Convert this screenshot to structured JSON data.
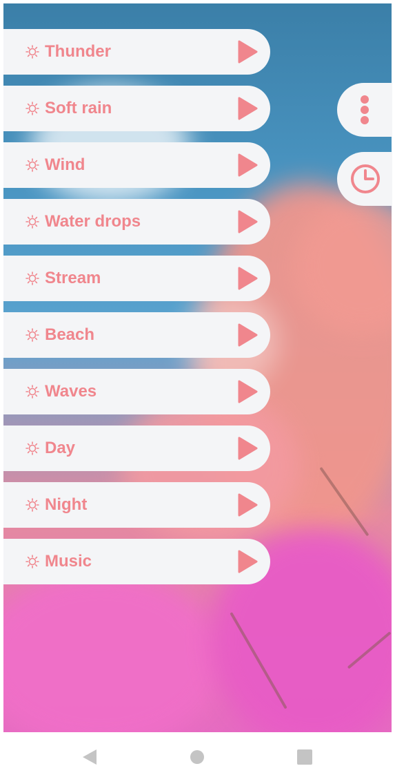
{
  "sounds": [
    {
      "label": "Thunder"
    },
    {
      "label": "Soft rain"
    },
    {
      "label": "Wind"
    },
    {
      "label": "Water drops"
    },
    {
      "label": "Stream"
    },
    {
      "label": "Beach"
    },
    {
      "label": "Waves"
    },
    {
      "label": "Day"
    },
    {
      "label": "Night"
    },
    {
      "label": "Music"
    }
  ],
  "icons": {
    "row_icon": "sun-icon",
    "row_action": "play-icon",
    "menu": "more-vertical-icon",
    "timer": "timer-icon",
    "nav_back": "back-icon",
    "nav_home": "home-icon",
    "nav_recent": "recent-apps-icon"
  },
  "colors": {
    "accent": "#f0868d",
    "pill_bg": "#f4f5f7",
    "nav_icon": "#c4c4c4"
  }
}
